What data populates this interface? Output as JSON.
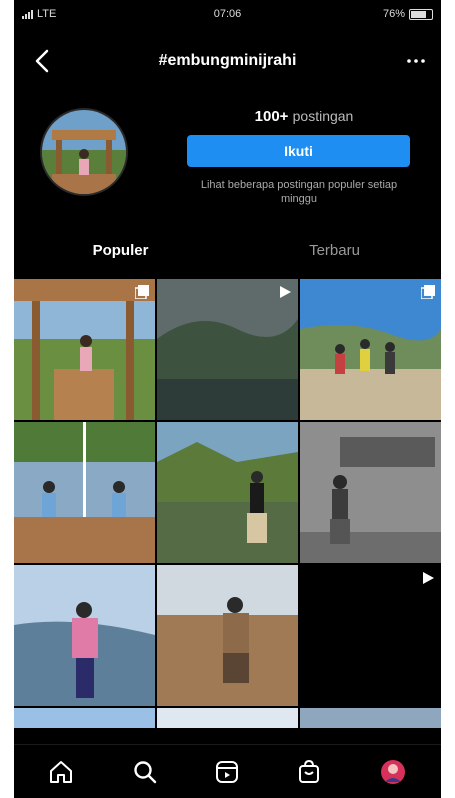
{
  "status_bar": {
    "carrier": "LTE",
    "time": "07:06",
    "battery": "76%"
  },
  "header": {
    "title": "#embungminijrahi",
    "back_icon": "chevron-left-icon",
    "more_icon": "more-horizontal-icon"
  },
  "profile": {
    "post_count": "100+",
    "post_count_label": "postingan",
    "follow_label": "Ikuti",
    "hint_text": "Lihat beberapa postingan populer setiap minggu"
  },
  "tabs": [
    {
      "label": "Populer",
      "active": true
    },
    {
      "label": "Terbaru",
      "active": false
    }
  ],
  "grid": {
    "posts": [
      {
        "type": "carousel",
        "image": "gazebo-hills"
      },
      {
        "type": "video",
        "image": "misty-lake"
      },
      {
        "type": "carousel",
        "image": "group-rocks"
      },
      {
        "type": "photo",
        "image": "wooden-table-split"
      },
      {
        "type": "photo",
        "image": "lake-man-sitting"
      },
      {
        "type": "photo",
        "image": "man-wall-sign"
      },
      {
        "type": "photo",
        "image": "woman-pink-mountains"
      },
      {
        "type": "photo",
        "image": "woman-wood-table"
      },
      {
        "type": "video",
        "image": "dark"
      }
    ]
  },
  "bottom_nav": [
    {
      "icon": "home-icon"
    },
    {
      "icon": "search-icon"
    },
    {
      "icon": "reels-icon"
    },
    {
      "icon": "shop-icon"
    },
    {
      "icon": "profile-avatar-icon"
    }
  ]
}
